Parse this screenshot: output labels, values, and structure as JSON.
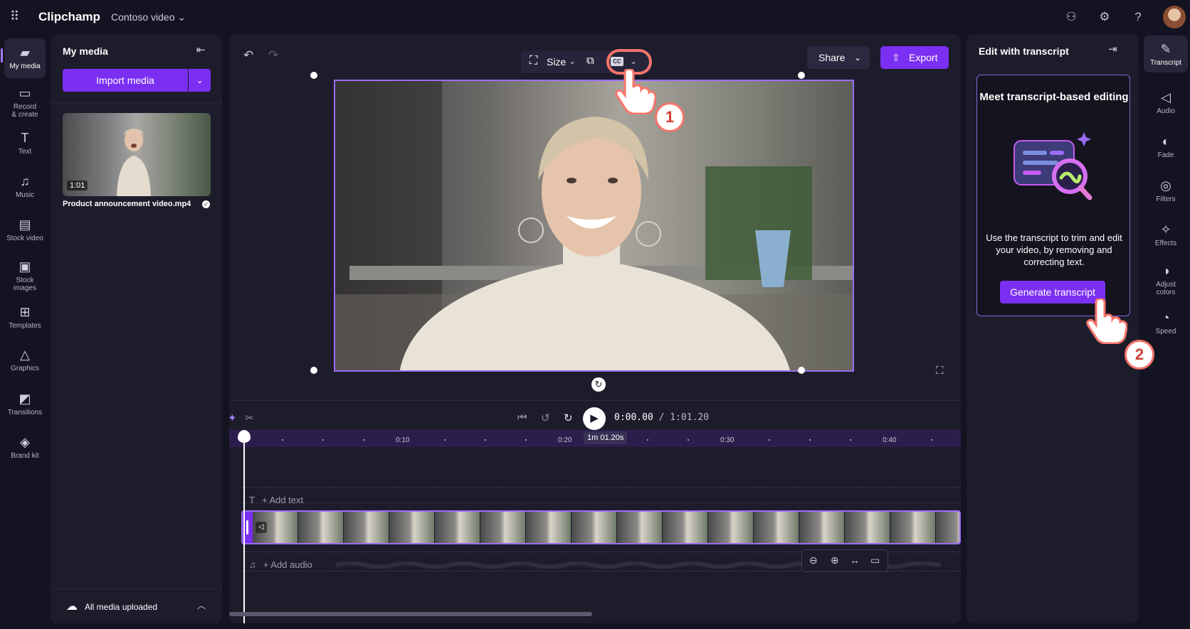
{
  "app": {
    "brand": "Clipchamp",
    "project_name": "Contoso video ⌄"
  },
  "left_rail": {
    "items": [
      {
        "label": "My media",
        "icon": "folder-icon"
      },
      {
        "label": "Record & create",
        "icon": "camera-icon"
      },
      {
        "label": "Text",
        "icon": "text-icon"
      },
      {
        "label": "Music",
        "icon": "music-icon"
      },
      {
        "label": "Stock video",
        "icon": "film-icon"
      },
      {
        "label": "Stock images",
        "icon": "image-icon"
      },
      {
        "label": "Templates",
        "icon": "templates-icon"
      },
      {
        "label": "Graphics",
        "icon": "shapes-icon"
      },
      {
        "label": "Transitions",
        "icon": "transitions-icon"
      },
      {
        "label": "Brand kit",
        "icon": "brand-icon"
      }
    ]
  },
  "media_panel": {
    "title": "My media",
    "import_label": "Import media",
    "item": {
      "duration": "1:01",
      "filename": "Product announcement video.mp4"
    },
    "footer_status": "All media uploaded"
  },
  "preview": {
    "size_label": "Size",
    "cc_label": "CC",
    "share_label": "Share",
    "export_label": "Export"
  },
  "timeline": {
    "current_time": "0:00.00",
    "total_time": "/ 1:01.20",
    "marker_label": "1m 01.20s",
    "ticks": [
      "0:10",
      "0:20",
      "0:30",
      "0:40"
    ],
    "add_text": "+ Add text",
    "add_audio": "+ Add audio"
  },
  "transcript_panel": {
    "title": "Edit with transcript",
    "card_heading": "Meet transcript-based editing",
    "card_description": "Use the transcript to trim and edit your video, by removing and correcting text.",
    "generate_label": "Generate transcript"
  },
  "right_rail": {
    "items": [
      {
        "label": "Transcript",
        "icon": "transcript-icon"
      },
      {
        "label": "Audio",
        "icon": "speaker-icon"
      },
      {
        "label": "Fade",
        "icon": "fade-icon"
      },
      {
        "label": "Filters",
        "icon": "filters-icon"
      },
      {
        "label": "Effects",
        "icon": "wand-icon"
      },
      {
        "label": "Adjust colors",
        "icon": "contrast-icon"
      },
      {
        "label": "Speed",
        "icon": "speedometer-icon"
      }
    ]
  },
  "annotations": {
    "step1": "1",
    "step2": "2"
  },
  "colors": {
    "accent": "#7b2ff2",
    "highlight": "#f6756b",
    "panel": "#1d1c2b",
    "background": "#141321"
  }
}
